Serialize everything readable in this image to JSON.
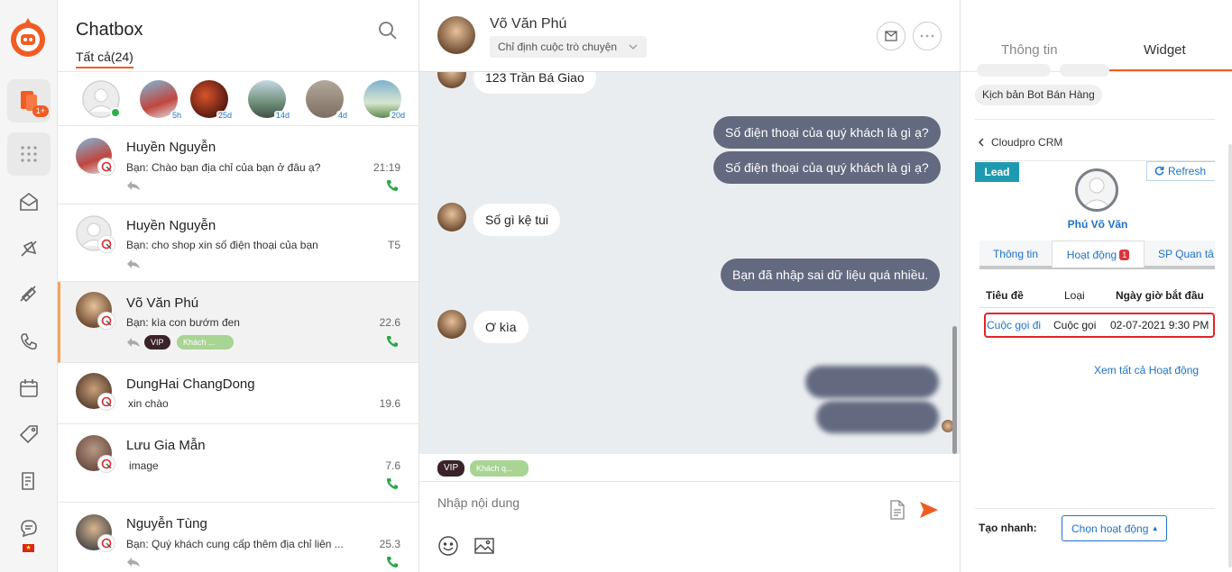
{
  "rail": {
    "notif_badge": "1+",
    "flag_icon": "vietnam-flag-icon",
    "icons": [
      "chatbox-icon",
      "apps-grid-icon",
      "mail-icon",
      "campaign-icon",
      "ticket-icon",
      "phone-icon",
      "calendar-icon",
      "tag-icon",
      "report-icon",
      "support-chat-icon"
    ]
  },
  "list": {
    "title": "Chatbox",
    "filter_tab": "Tất cả(24)",
    "stories": [
      {
        "age": ""
      },
      {
        "age": "5h"
      },
      {
        "age": "25d"
      },
      {
        "age": "14d"
      },
      {
        "age": "4d"
      },
      {
        "age": "20d"
      }
    ],
    "conversations": [
      {
        "name": "Huyền Nguyễn",
        "message": "Bạn: Chào bạn địa chỉ của bạn ở đâu ạ?",
        "time": "21:19"
      },
      {
        "name": "Huyền Nguyễn",
        "message": "Bạn: cho shop xin số điện thoại của bạn",
        "time": "T5"
      },
      {
        "name": "Võ Văn Phú",
        "message": "Bạn: kìa con bướm đen",
        "time": "22.6",
        "tag_vip": "VIP",
        "tag_customer": "Khách ..."
      },
      {
        "name": "DungHai ChangDong",
        "message": "xin chào",
        "time": "19.6"
      },
      {
        "name": "Lưu Gia Mẫn",
        "message": "image",
        "time": "7.6"
      },
      {
        "name": "Nguyễn Tùng",
        "message": "Bạn: Quý khách cung cấp thêm địa chỉ liên ...",
        "time": "25.3"
      }
    ]
  },
  "chat": {
    "contact_name": "Võ Văn Phú",
    "assign_label": "Chỉ định cuộc trò chuyện",
    "messages": [
      {
        "text": "123 Trần Bá Giao"
      },
      {
        "text": "Số điện thoại của quý khách là gì ạ?"
      },
      {
        "text": "Số điện thoại của quý khách là gì ạ?"
      },
      {
        "text": "Số gì kệ tui"
      },
      {
        "text": "Bạn đã nhập sai dữ liệu quá nhiều."
      },
      {
        "text": "Ơ kìa"
      }
    ],
    "tag_vip": "VIP",
    "tag_customer": "Khách q...",
    "input_placeholder": "Nhập nội dung"
  },
  "right": {
    "tab_info": "Thông tin",
    "tab_widget": "Widget",
    "script_pill": "Kịch bản Bot Bán Hàng",
    "crm_back": "Cloudpro CRM",
    "lead_badge": "Lead",
    "refresh": "Refresh",
    "crm_name": "Phú Võ Văn",
    "subtabs": {
      "info": "Thông tin",
      "activity": "Hoạt động",
      "activity_count": "1",
      "products": "SP Quan tâ"
    },
    "table_headers": {
      "title": "Tiêu đề",
      "type": "Loại",
      "start": "Ngày giờ bắt đầu"
    },
    "row": {
      "title": "Cuộc gọi đi",
      "type": "Cuộc gọi",
      "start": "02-07-2021 9:30 PM"
    },
    "see_all": "Xem tất cả Hoạt động",
    "quick_label": "Tạo nhanh:",
    "quick_button": "Chọn hoạt động"
  },
  "colors": {
    "accent": "#f25c22",
    "link": "#1d72c9",
    "outgoing_bubble": "#636a80",
    "chat_bg": "#eaedf0",
    "lead": "#1e9ab0",
    "call_green": "#28a745"
  }
}
